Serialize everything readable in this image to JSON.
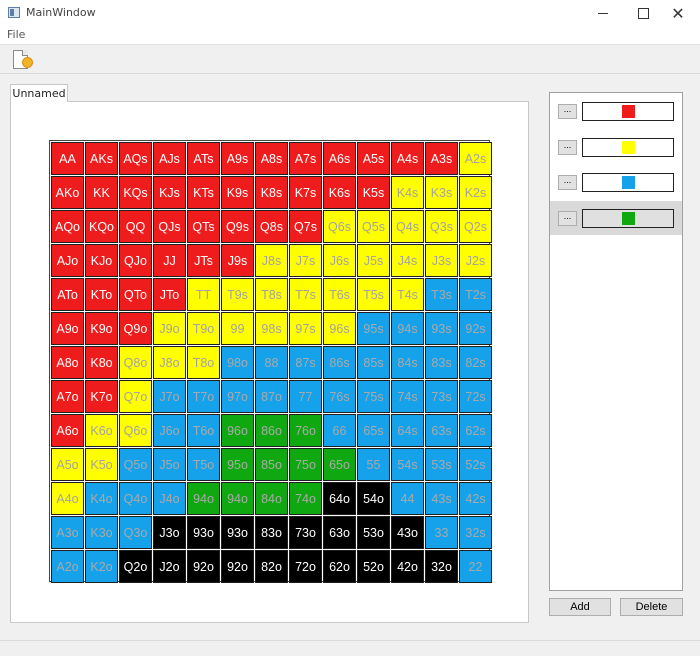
{
  "window": {
    "title": "MainWindow"
  },
  "menu": {
    "file": "File"
  },
  "tabs": [
    {
      "label": "Unnamed"
    }
  ],
  "palette": {
    "red": {
      "bg": "#ee1c1c",
      "fg": "#ffffff"
    },
    "yellow": {
      "bg": "#ffff00",
      "fg": "#a3a3a3"
    },
    "blue": {
      "bg": "#16a2ea",
      "fg": "#a9a9a9"
    },
    "green": {
      "bg": "#10a810",
      "fg": "#a9a9a9"
    },
    "black": {
      "bg": "#000000",
      "fg": "#ffffff"
    }
  },
  "color_groups": [
    {
      "button": "...",
      "color": "#ee1c1c",
      "selected": false
    },
    {
      "button": "...",
      "color": "#ffff00",
      "selected": false
    },
    {
      "button": "...",
      "color": "#16a2ea",
      "selected": false
    },
    {
      "button": "...",
      "color": "#10a810",
      "selected": true
    }
  ],
  "buttons": {
    "add": "Add",
    "delete": "Delete"
  },
  "grid": [
    [
      {
        "t": "AA",
        "c": "red"
      },
      {
        "t": "AKs",
        "c": "red"
      },
      {
        "t": "AQs",
        "c": "red"
      },
      {
        "t": "AJs",
        "c": "red"
      },
      {
        "t": "ATs",
        "c": "red"
      },
      {
        "t": "A9s",
        "c": "red"
      },
      {
        "t": "A8s",
        "c": "red"
      },
      {
        "t": "A7s",
        "c": "red"
      },
      {
        "t": "A6s",
        "c": "red"
      },
      {
        "t": "A5s",
        "c": "red"
      },
      {
        "t": "A4s",
        "c": "red"
      },
      {
        "t": "A3s",
        "c": "red"
      },
      {
        "t": "A2s",
        "c": "yellow"
      }
    ],
    [
      {
        "t": "AKo",
        "c": "red"
      },
      {
        "t": "KK",
        "c": "red"
      },
      {
        "t": "KQs",
        "c": "red"
      },
      {
        "t": "KJs",
        "c": "red"
      },
      {
        "t": "KTs",
        "c": "red"
      },
      {
        "t": "K9s",
        "c": "red"
      },
      {
        "t": "K8s",
        "c": "red"
      },
      {
        "t": "K7s",
        "c": "red"
      },
      {
        "t": "K6s",
        "c": "red"
      },
      {
        "t": "K5s",
        "c": "red"
      },
      {
        "t": "K4s",
        "c": "yellow"
      },
      {
        "t": "K3s",
        "c": "yellow"
      },
      {
        "t": "K2s",
        "c": "yellow"
      }
    ],
    [
      {
        "t": "AQo",
        "c": "red"
      },
      {
        "t": "KQo",
        "c": "red"
      },
      {
        "t": "QQ",
        "c": "red"
      },
      {
        "t": "QJs",
        "c": "red"
      },
      {
        "t": "QTs",
        "c": "red"
      },
      {
        "t": "Q9s",
        "c": "red"
      },
      {
        "t": "Q8s",
        "c": "red"
      },
      {
        "t": "Q7s",
        "c": "red"
      },
      {
        "t": "Q6s",
        "c": "yellow"
      },
      {
        "t": "Q5s",
        "c": "yellow"
      },
      {
        "t": "Q4s",
        "c": "yellow"
      },
      {
        "t": "Q3s",
        "c": "yellow"
      },
      {
        "t": "Q2s",
        "c": "yellow"
      }
    ],
    [
      {
        "t": "AJo",
        "c": "red"
      },
      {
        "t": "KJo",
        "c": "red"
      },
      {
        "t": "QJo",
        "c": "red"
      },
      {
        "t": "JJ",
        "c": "red"
      },
      {
        "t": "JTs",
        "c": "red"
      },
      {
        "t": "J9s",
        "c": "red"
      },
      {
        "t": "J8s",
        "c": "yellow"
      },
      {
        "t": "J7s",
        "c": "yellow"
      },
      {
        "t": "J6s",
        "c": "yellow"
      },
      {
        "t": "J5s",
        "c": "yellow"
      },
      {
        "t": "J4s",
        "c": "yellow"
      },
      {
        "t": "J3s",
        "c": "yellow"
      },
      {
        "t": "J2s",
        "c": "yellow"
      }
    ],
    [
      {
        "t": "ATo",
        "c": "red"
      },
      {
        "t": "KTo",
        "c": "red"
      },
      {
        "t": "QTo",
        "c": "red"
      },
      {
        "t": "JTo",
        "c": "red"
      },
      {
        "t": "TT",
        "c": "yellow"
      },
      {
        "t": "T9s",
        "c": "yellow"
      },
      {
        "t": "T8s",
        "c": "yellow"
      },
      {
        "t": "T7s",
        "c": "yellow"
      },
      {
        "t": "T6s",
        "c": "yellow"
      },
      {
        "t": "T5s",
        "c": "yellow"
      },
      {
        "t": "T4s",
        "c": "yellow"
      },
      {
        "t": "T3s",
        "c": "blue"
      },
      {
        "t": "T2s",
        "c": "blue"
      }
    ],
    [
      {
        "t": "A9o",
        "c": "red"
      },
      {
        "t": "K9o",
        "c": "red"
      },
      {
        "t": "Q9o",
        "c": "red"
      },
      {
        "t": "J9o",
        "c": "yellow"
      },
      {
        "t": "T9o",
        "c": "yellow"
      },
      {
        "t": "99",
        "c": "yellow"
      },
      {
        "t": "98s",
        "c": "yellow"
      },
      {
        "t": "97s",
        "c": "yellow"
      },
      {
        "t": "96s",
        "c": "yellow"
      },
      {
        "t": "95s",
        "c": "blue"
      },
      {
        "t": "94s",
        "c": "blue"
      },
      {
        "t": "93s",
        "c": "blue"
      },
      {
        "t": "92s",
        "c": "blue"
      }
    ],
    [
      {
        "t": "A8o",
        "c": "red"
      },
      {
        "t": "K8o",
        "c": "red"
      },
      {
        "t": "Q8o",
        "c": "yellow"
      },
      {
        "t": "J8o",
        "c": "yellow"
      },
      {
        "t": "T8o",
        "c": "yellow"
      },
      {
        "t": "98o",
        "c": "blue"
      },
      {
        "t": "88",
        "c": "blue"
      },
      {
        "t": "87s",
        "c": "blue"
      },
      {
        "t": "86s",
        "c": "blue"
      },
      {
        "t": "85s",
        "c": "blue"
      },
      {
        "t": "84s",
        "c": "blue"
      },
      {
        "t": "83s",
        "c": "blue"
      },
      {
        "t": "82s",
        "c": "blue"
      }
    ],
    [
      {
        "t": "A7o",
        "c": "red"
      },
      {
        "t": "K7o",
        "c": "red"
      },
      {
        "t": "Q7o",
        "c": "yellow"
      },
      {
        "t": "J7o",
        "c": "blue"
      },
      {
        "t": "T7o",
        "c": "blue"
      },
      {
        "t": "97o",
        "c": "blue"
      },
      {
        "t": "87o",
        "c": "blue"
      },
      {
        "t": "77",
        "c": "blue"
      },
      {
        "t": "76s",
        "c": "blue"
      },
      {
        "t": "75s",
        "c": "blue"
      },
      {
        "t": "74s",
        "c": "blue"
      },
      {
        "t": "73s",
        "c": "blue"
      },
      {
        "t": "72s",
        "c": "blue"
      }
    ],
    [
      {
        "t": "A6o",
        "c": "red"
      },
      {
        "t": "K6o",
        "c": "yellow"
      },
      {
        "t": "Q6o",
        "c": "yellow"
      },
      {
        "t": "J6o",
        "c": "blue"
      },
      {
        "t": "T6o",
        "c": "blue"
      },
      {
        "t": "96o",
        "c": "green"
      },
      {
        "t": "86o",
        "c": "green"
      },
      {
        "t": "76o",
        "c": "green"
      },
      {
        "t": "66",
        "c": "blue"
      },
      {
        "t": "65s",
        "c": "blue"
      },
      {
        "t": "64s",
        "c": "blue"
      },
      {
        "t": "63s",
        "c": "blue"
      },
      {
        "t": "62s",
        "c": "blue"
      }
    ],
    [
      {
        "t": "A5o",
        "c": "yellow"
      },
      {
        "t": "K5o",
        "c": "yellow"
      },
      {
        "t": "Q5o",
        "c": "blue"
      },
      {
        "t": "J5o",
        "c": "blue"
      },
      {
        "t": "T5o",
        "c": "blue"
      },
      {
        "t": "95o",
        "c": "green"
      },
      {
        "t": "85o",
        "c": "green"
      },
      {
        "t": "75o",
        "c": "green"
      },
      {
        "t": "65o",
        "c": "green"
      },
      {
        "t": "55",
        "c": "blue"
      },
      {
        "t": "54s",
        "c": "blue"
      },
      {
        "t": "53s",
        "c": "blue"
      },
      {
        "t": "52s",
        "c": "blue"
      }
    ],
    [
      {
        "t": "A4o",
        "c": "yellow"
      },
      {
        "t": "K4o",
        "c": "blue"
      },
      {
        "t": "Q4o",
        "c": "blue"
      },
      {
        "t": "J4o",
        "c": "blue"
      },
      {
        "t": "94o",
        "c": "green"
      },
      {
        "t": "94o",
        "c": "green"
      },
      {
        "t": "84o",
        "c": "green"
      },
      {
        "t": "74o",
        "c": "green"
      },
      {
        "t": "64o",
        "c": "black"
      },
      {
        "t": "54o",
        "c": "black"
      },
      {
        "t": "44",
        "c": "blue"
      },
      {
        "t": "43s",
        "c": "blue"
      },
      {
        "t": "42s",
        "c": "blue"
      }
    ],
    [
      {
        "t": "A3o",
        "c": "blue"
      },
      {
        "t": "K3o",
        "c": "blue"
      },
      {
        "t": "Q3o",
        "c": "blue"
      },
      {
        "t": "J3o",
        "c": "black"
      },
      {
        "t": "93o",
        "c": "black"
      },
      {
        "t": "93o",
        "c": "black"
      },
      {
        "t": "83o",
        "c": "black"
      },
      {
        "t": "73o",
        "c": "black"
      },
      {
        "t": "63o",
        "c": "black"
      },
      {
        "t": "53o",
        "c": "black"
      },
      {
        "t": "43o",
        "c": "black"
      },
      {
        "t": "33",
        "c": "blue"
      },
      {
        "t": "32s",
        "c": "blue"
      }
    ],
    [
      {
        "t": "A2o",
        "c": "blue"
      },
      {
        "t": "K2o",
        "c": "blue"
      },
      {
        "t": "Q2o",
        "c": "black"
      },
      {
        "t": "J2o",
        "c": "black"
      },
      {
        "t": "92o",
        "c": "black"
      },
      {
        "t": "92o",
        "c": "black"
      },
      {
        "t": "82o",
        "c": "black"
      },
      {
        "t": "72o",
        "c": "black"
      },
      {
        "t": "62o",
        "c": "black"
      },
      {
        "t": "52o",
        "c": "black"
      },
      {
        "t": "42o",
        "c": "black"
      },
      {
        "t": "32o",
        "c": "black"
      },
      {
        "t": "22",
        "c": "blue"
      }
    ]
  ]
}
